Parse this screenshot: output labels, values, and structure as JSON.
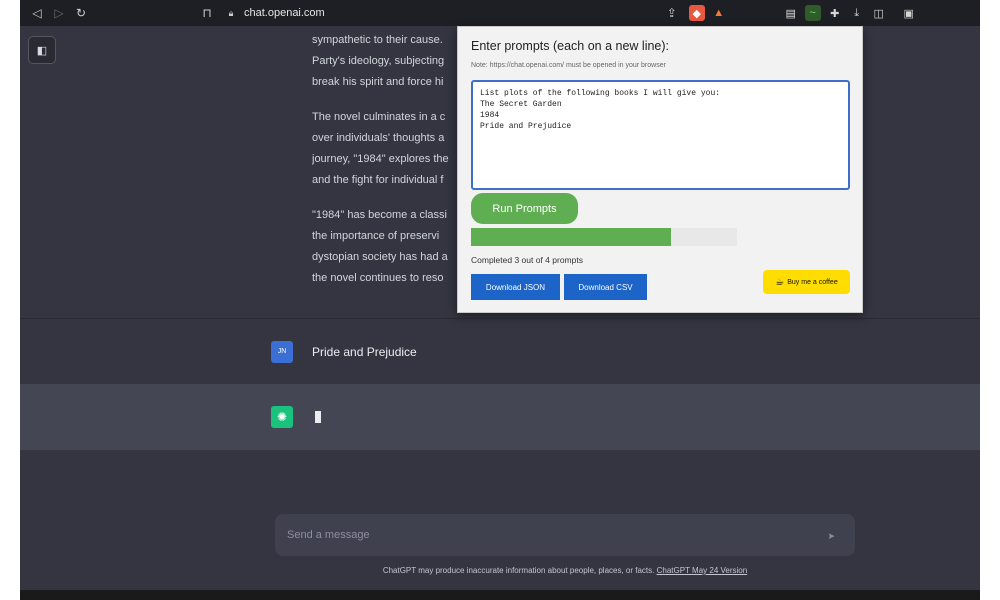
{
  "browser": {
    "url": "chat.openai.com",
    "icons": [
      "back-icon",
      "forward-icon",
      "reload-icon",
      "bookmark-icon",
      "lock-icon",
      "share-icon",
      "brave-shield-icon",
      "alert-icon",
      "reader-icon",
      "extension-icon",
      "puzzle-icon",
      "download-icon",
      "sidebar-icon",
      "wallet-icon"
    ]
  },
  "chat": {
    "answer_paragraphs": [
      [
        "sympathetic to their cause.",
        "Party's ideology, subjecting",
        "break his spirit and force hi"
      ],
      [
        "The novel culminates in a c",
        "over individuals' thoughts a",
        "journey, \"1984\" explores the",
        "and the fight for individual f"
      ],
      [
        "\"1984\" has become a classi",
        "the importance of preservi",
        "dystopian society has had a",
        "the novel continues to reso"
      ]
    ],
    "user_avatar": "JN",
    "user_message": "Pride and Prejudice",
    "composer_placeholder": "Send a message",
    "disclaimer": "ChatGPT may produce inaccurate information about people, places, or facts.",
    "disclaimer_link": "ChatGPT May 24 Version"
  },
  "popup": {
    "title": "Enter prompts (each on a new line):",
    "note": "Note: https://chat.openai.com/ must be opened in your browser",
    "prompts": "List plots of the following books I will give you:\nThe Secret Garden\n1984\nPride and Prejudice",
    "run_label": "Run Prompts",
    "progress_completed": 3,
    "progress_total": 4,
    "progress_text": "Completed 3 out of 4 prompts",
    "download_json_label": "Download JSON",
    "download_csv_label": "Download CSV",
    "coffee_label": "Buy me a coffee",
    "colors": {
      "accent_green": "#5fae52",
      "button_blue": "#1c64c8",
      "coffee_yellow": "#ffdd00"
    }
  }
}
